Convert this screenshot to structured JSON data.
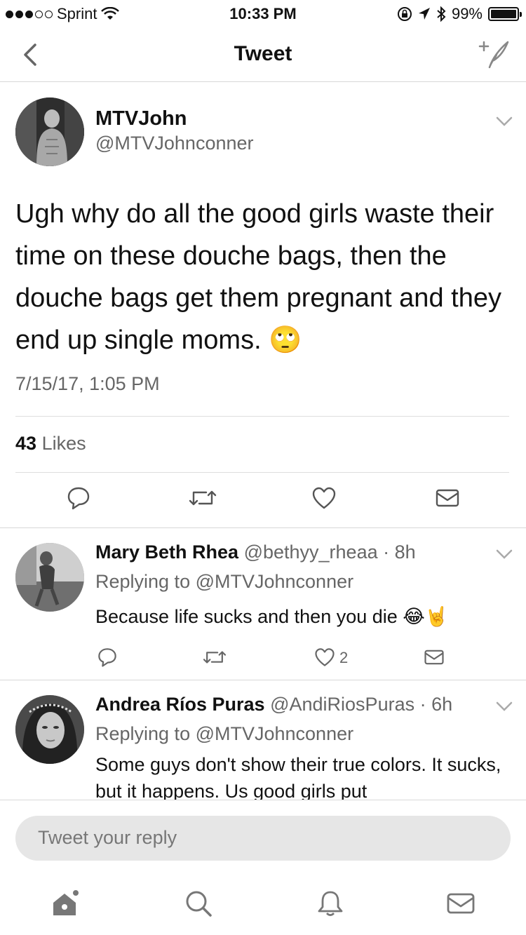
{
  "status": {
    "carrier": "Sprint",
    "time": "10:33 PM",
    "battery": "99%",
    "battery_level": 0.99
  },
  "nav": {
    "title": "Tweet"
  },
  "tweet": {
    "name": "MTVJohn",
    "handle": "@MTVJohnconner",
    "text": "Ugh why do all the good girls waste their time on these douche bags, then the douche bags get them pregnant and they end up single moms. 🙄",
    "timestamp": "7/15/17, 1:05 PM",
    "likes_count": "43",
    "likes_label": "Likes"
  },
  "replies": [
    {
      "name": "Mary Beth Rhea",
      "handle": "@bethyy_rheaa",
      "age": "· 8h",
      "replying_to": "Replying to @MTVJohnconner",
      "text": "Because life sucks and then you die 😂🤘",
      "like_count": "2"
    },
    {
      "name": "Andrea Ríos Puras",
      "handle": "@AndiRiosPuras",
      "age": "· 6h",
      "replying_to": "Replying to @MTVJohnconner",
      "text": "Some guys don't show their true colors. It sucks, but it happens. Us good girls put"
    }
  ],
  "reply_bar": {
    "placeholder": "Tweet your reply"
  },
  "icons": {
    "back": "chevron-left-icon",
    "compose": "compose-tweet-icon",
    "reply": "reply-icon",
    "retweet": "retweet-icon",
    "like": "heart-icon",
    "dm": "envelope-icon",
    "home": "home-icon",
    "search": "search-icon",
    "notifications": "bell-icon",
    "messages": "envelope-icon"
  }
}
